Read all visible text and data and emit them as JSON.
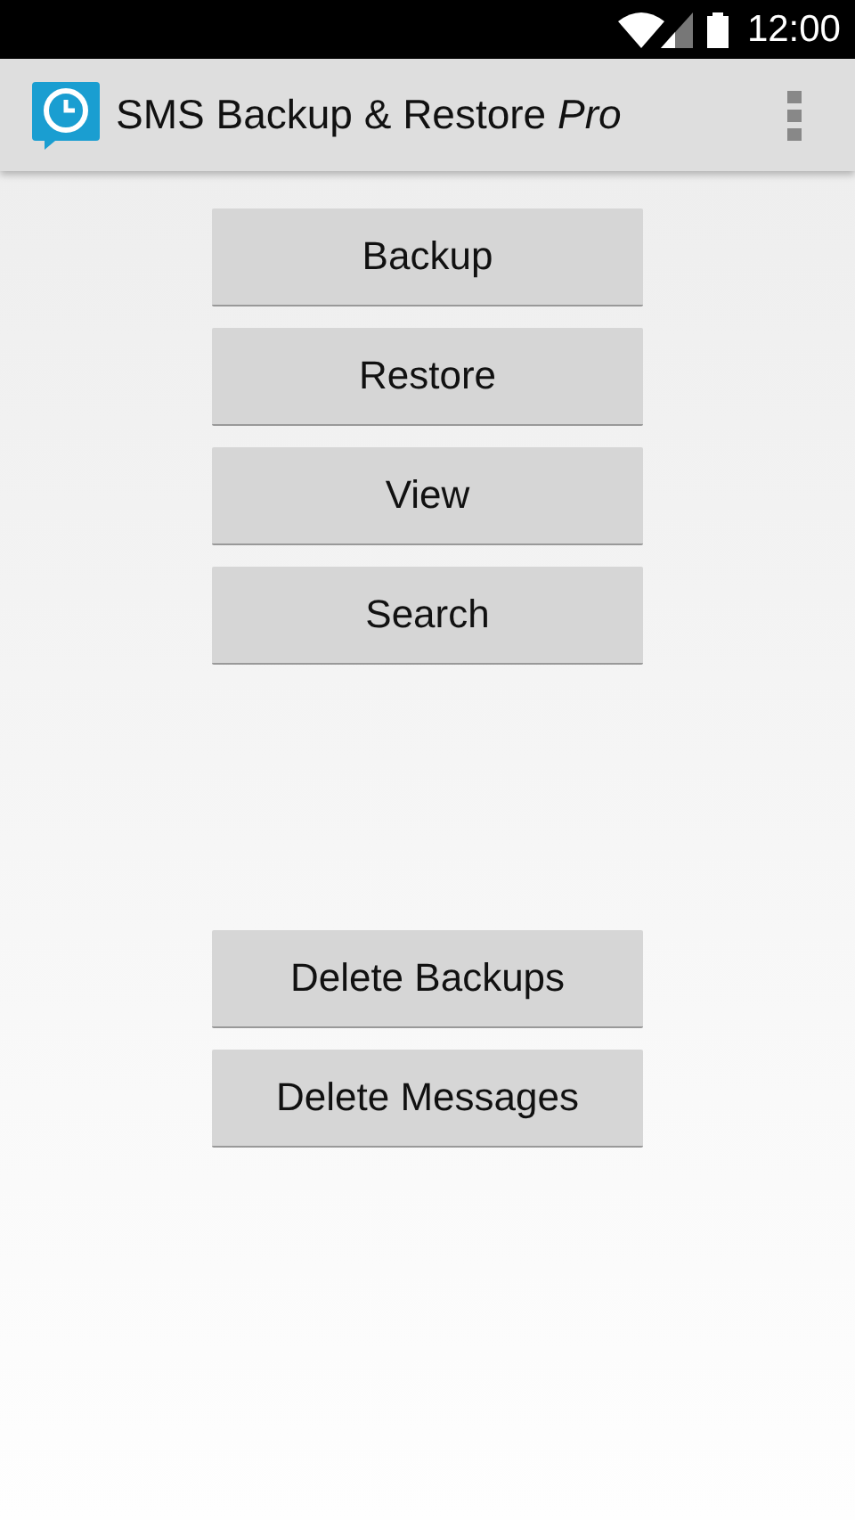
{
  "status_bar": {
    "time": "12:00"
  },
  "action_bar": {
    "title": "SMS Backup & Restore *Pro*"
  },
  "main_buttons": [
    {
      "label": "Backup"
    },
    {
      "label": "Restore"
    },
    {
      "label": "View"
    },
    {
      "label": "Search"
    }
  ],
  "delete_buttons": [
    {
      "label": "Delete Backups"
    },
    {
      "label": "Delete Messages"
    }
  ]
}
